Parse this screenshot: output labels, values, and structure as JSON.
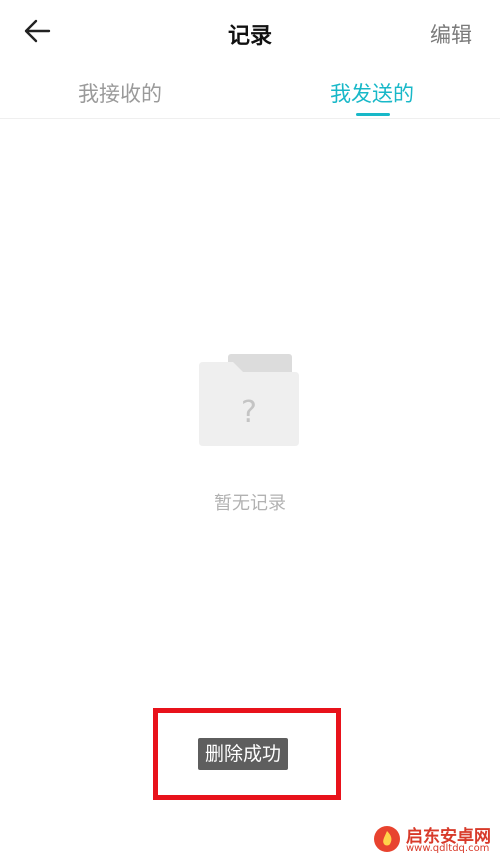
{
  "header": {
    "back_icon": "arrow-left-icon",
    "title": "记录",
    "edit_label": "编辑"
  },
  "tabs": [
    {
      "label": "我接收的",
      "active": false
    },
    {
      "label": "我发送的",
      "active": true
    }
  ],
  "colors": {
    "accent": "#18b8c8",
    "inactive_tab": "#9a9a9a",
    "toast_bg": "#5e5e5e",
    "highlight_frame": "#e8121b"
  },
  "empty_state": {
    "icon": "folder-question-icon",
    "icon_glyph": "?",
    "text": "暂无记录"
  },
  "toast": {
    "text": "删除成功"
  },
  "watermark": {
    "logo_icon": "flame-logo-icon",
    "name": "启东安卓网",
    "url": "www.qdltdq.com"
  }
}
